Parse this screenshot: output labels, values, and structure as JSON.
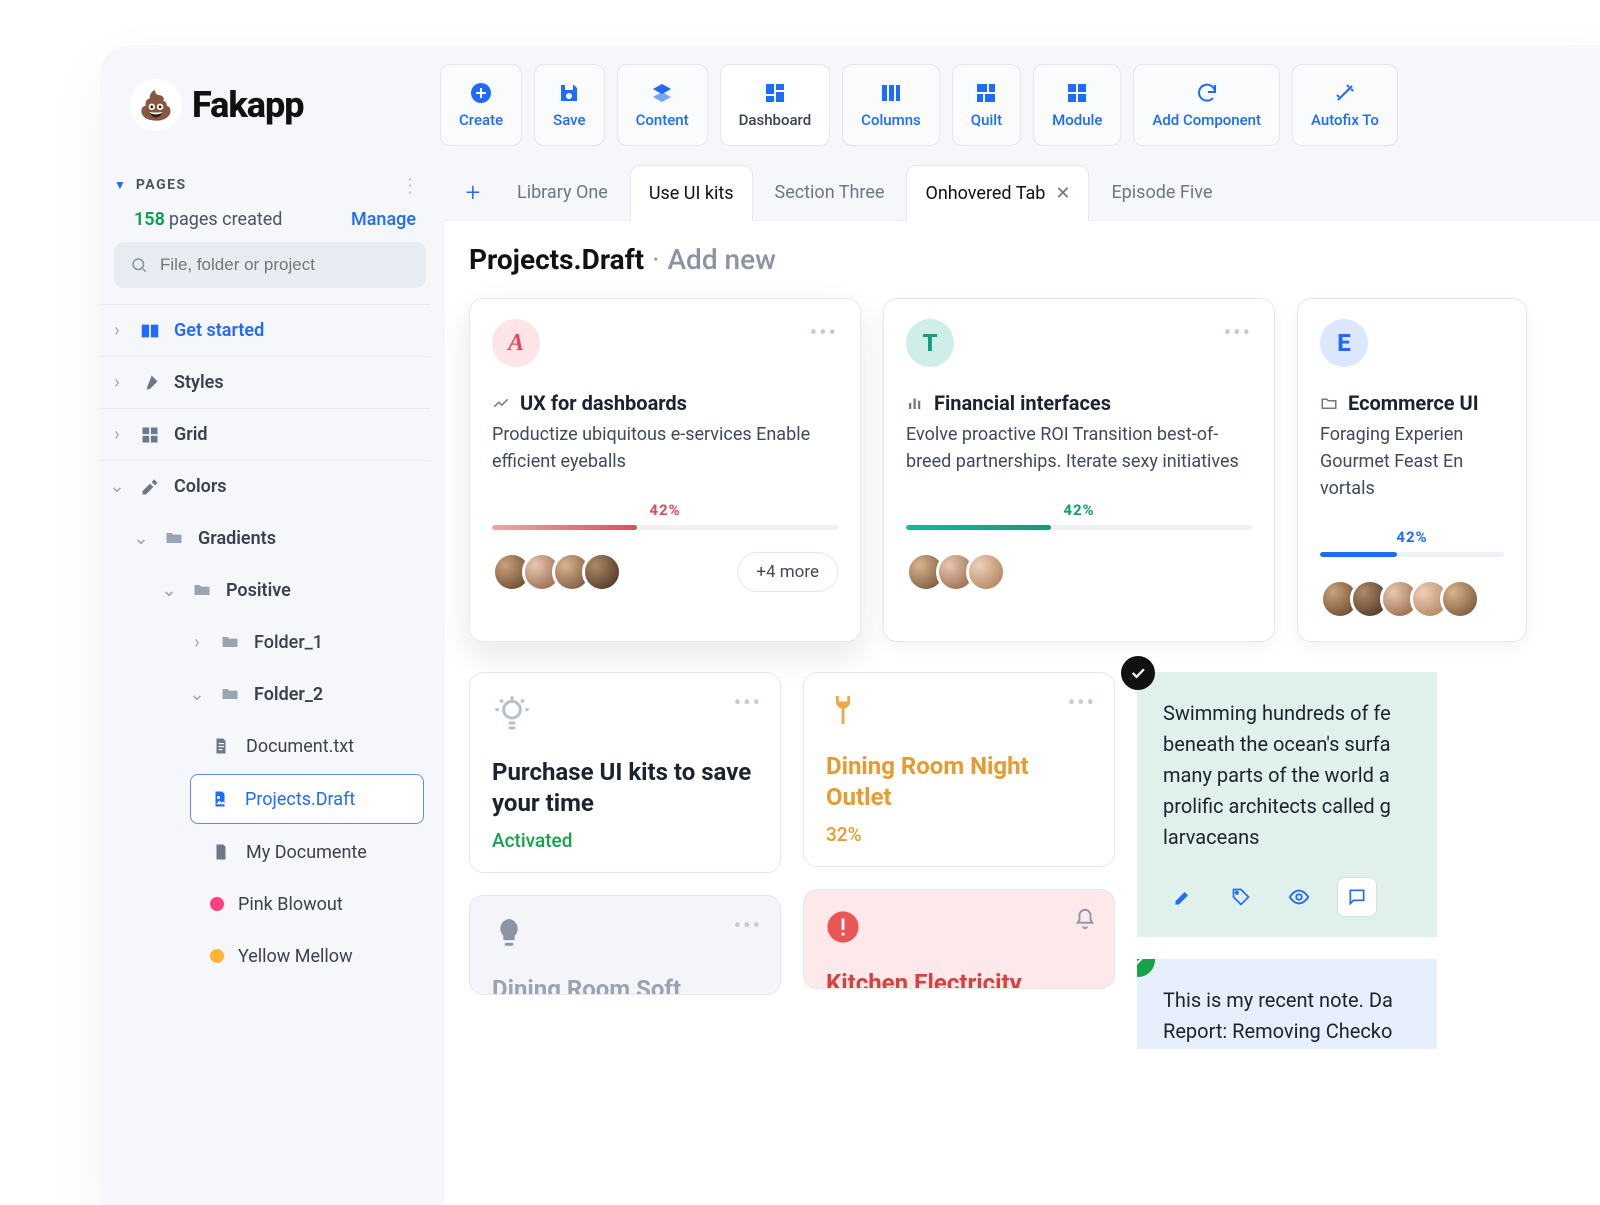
{
  "app": {
    "name": "Fakapp",
    "emoji": "💩"
  },
  "toolbar": {
    "create": "Create",
    "save": "Save",
    "content": "Content",
    "dashboard": "Dashboard",
    "columns": "Columns",
    "quilt": "Quilt",
    "module": "Module",
    "add_component": "Add Component",
    "autofix": "Autofix To"
  },
  "sidebar": {
    "pages_label": "PAGES",
    "pages_count": "158",
    "pages_created_text": "pages created",
    "manage": "Manage",
    "search_placeholder": "File, folder or project",
    "items": {
      "get_started": "Get started",
      "styles": "Styles",
      "grid": "Grid",
      "colors": "Colors",
      "gradients": "Gradients",
      "positive": "Positive",
      "folder1": "Folder_1",
      "folder2": "Folder_2",
      "doc_txt": "Document.txt",
      "projects_draft": "Projects.Draft",
      "my_documente": "My Documente",
      "pink_blowout": "Pink Blowout",
      "yellow_mellow": "Yellow Mellow"
    }
  },
  "tabs": {
    "t1": "Library One",
    "t2": "Use UI kits",
    "t3": "Section Three",
    "t4": "Onhovered Tab",
    "t5": "Episode Five"
  },
  "page": {
    "title": "Projects.Draft",
    "sep": "·",
    "add_new": "Add new"
  },
  "cards": {
    "a": {
      "letter": "A",
      "title": "UX for dashboards",
      "desc": "Productize ubiquitous e-services Enable efficient eyeballs",
      "pct": "42%",
      "more": "+4 more"
    },
    "t": {
      "letter": "T",
      "title": "Financial interfaces",
      "desc": "Evolve proactive ROI Transition best-of-breed partnerships. Iterate sexy initiatives",
      "pct": "42%"
    },
    "e": {
      "letter": "E",
      "title": "Ecommerce UI",
      "desc": "Foraging Experien Gourmet Feast En vortals",
      "pct": "42%"
    }
  },
  "small": {
    "bulb": {
      "title": "Purchase UI kits to save your time",
      "status": "Activated"
    },
    "plug": {
      "title": "Dining Room Night Outlet",
      "status": "32%"
    },
    "grey": {
      "title": "Dining Room Soft"
    },
    "red": {
      "title": "Kitchen Electricity"
    }
  },
  "notes": {
    "green": {
      "text": "Swimming hundreds of fe beneath the ocean's surfa many parts of the world a prolific architects called g larvaceans"
    },
    "blue": {
      "text": "This is my recent note. Da Report: Removing Checko"
    }
  }
}
